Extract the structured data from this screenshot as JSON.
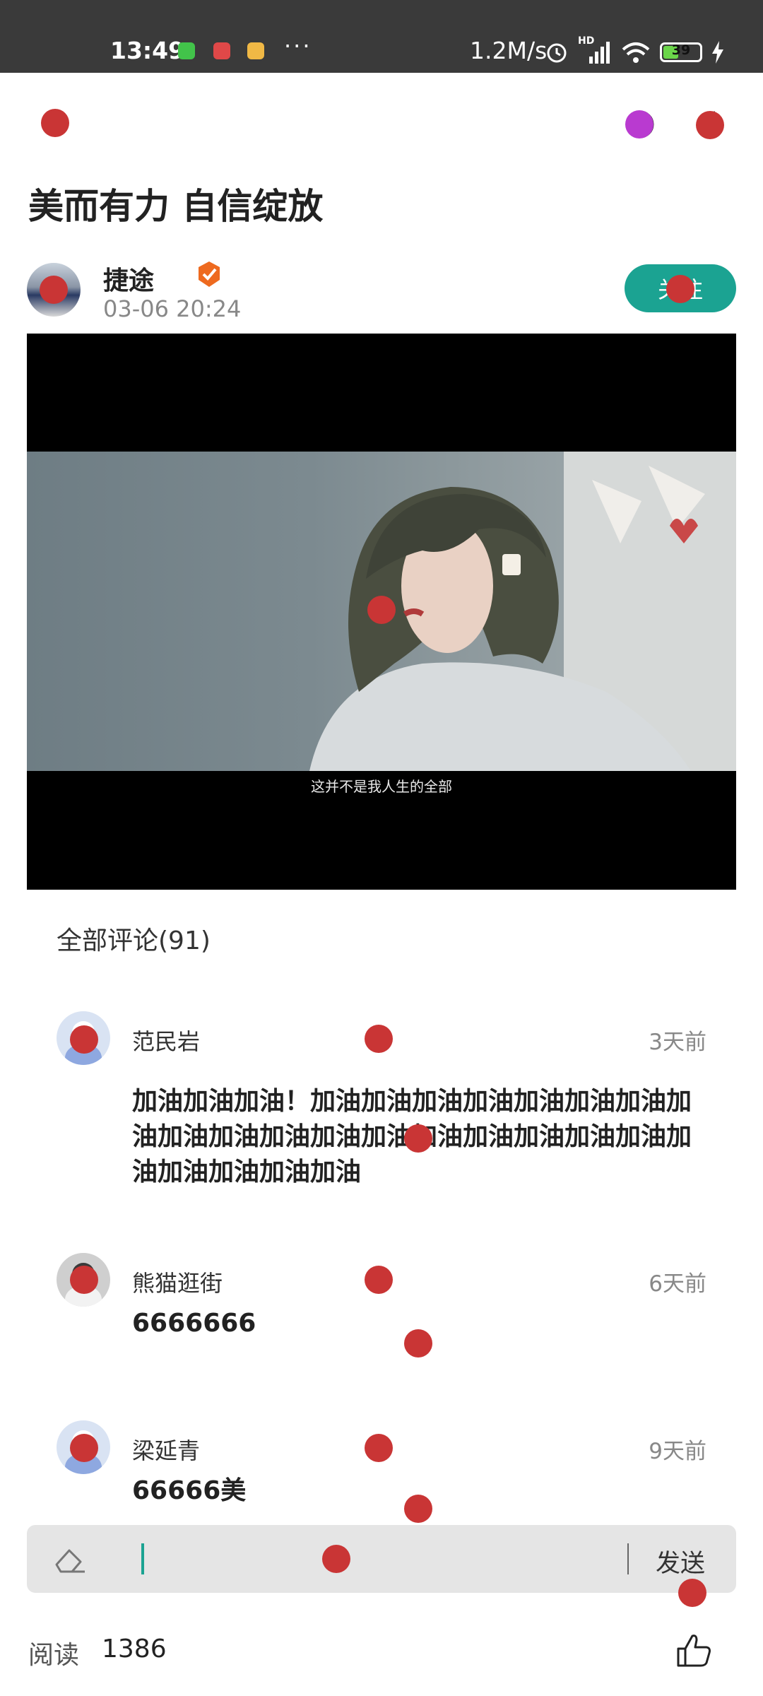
{
  "status_bar": {
    "time": "13:49",
    "dots": "···",
    "net_speed": "1.2M/s",
    "network_label": "HD",
    "battery_level": "39"
  },
  "article": {
    "title": "美而有力 自信绽放"
  },
  "author": {
    "name": "捷途",
    "time": "03-06 20:24",
    "follow_label": "关注"
  },
  "video": {
    "subtitle": "这并不是我人生的全部"
  },
  "comments": {
    "header": "全部评论(91)",
    "items": [
      {
        "name": "范民岩",
        "time": "3天前",
        "text": "加油加油加油！加油加油加油加油加油加油加油加油加油加油加油加油加油加油加油加油加油加油加油加油加油加油加油"
      },
      {
        "name": "熊猫逛街",
        "time": "6天前",
        "text": "6666666"
      },
      {
        "name": "梁延青",
        "time": "9天前",
        "text": "66666美"
      }
    ]
  },
  "input": {
    "send_label": "发送"
  },
  "footer": {
    "read_label": "阅读",
    "read_count": "1386"
  },
  "icons": {
    "back": "back-icon",
    "share": "share-icon",
    "refresh": "refresh-icon",
    "verified": "verified-icon",
    "eraser": "eraser-icon",
    "like": "thumbs-up-icon"
  }
}
